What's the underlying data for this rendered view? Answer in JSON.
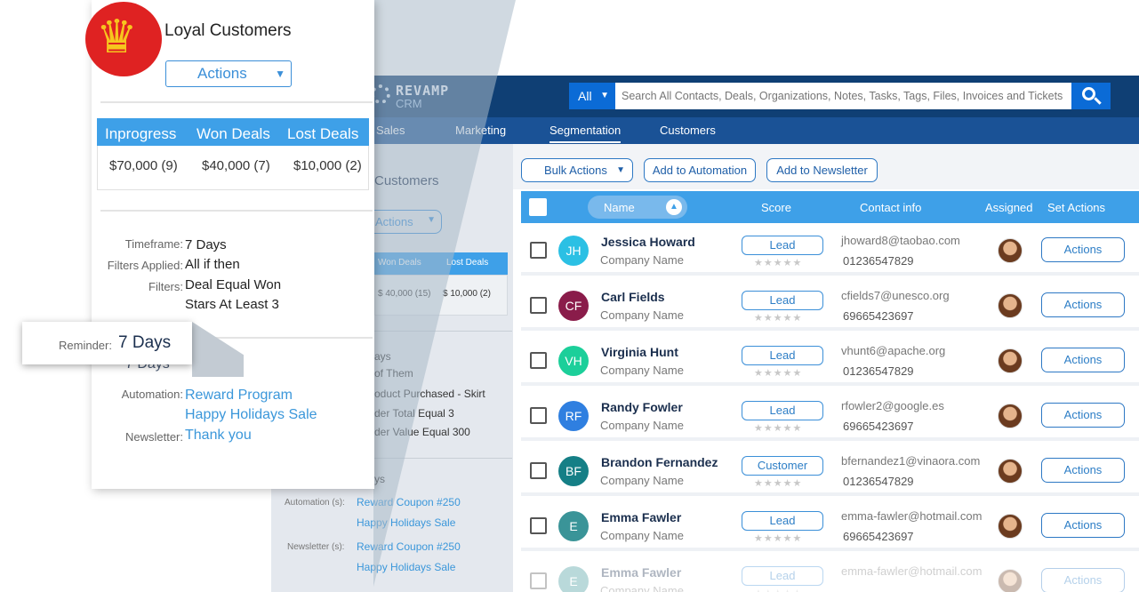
{
  "app": {
    "brand": "REVAMP",
    "brand_sub": "CRM",
    "search": {
      "scope": "All",
      "placeholder": "Search All Contacts, Deals, Organizations, Notes, Tasks, Tags, Files, Invoices and Tickets"
    },
    "nav": [
      "Sales",
      "Marketing",
      "Segmentation",
      "Customers"
    ],
    "left_panel": {
      "title": "Customers",
      "actions": "Actions",
      "won": "Won Deals",
      "lost": "Lost Deals",
      "won_val": "$ 40,000 (15)",
      "lost_val": "$ 10,000 (2)",
      "lines": [
        "ays",
        "of Them",
        "oduct Purchased - Skirt",
        "der Total Equal 3",
        "der Value Equal 300",
        "ys"
      ],
      "automation_label": "Automation (s):",
      "automation": [
        "Reward Coupon #250",
        "Happy Holidays Sale"
      ],
      "newsletter_label": "Newsletter (s):",
      "newsletter": [
        "Reward Coupon #250",
        "Happy Holidays Sale"
      ]
    },
    "toolbar": {
      "bulk": "Bulk Actions",
      "add_automation": "Add to Automation",
      "add_newsletter": "Add to Newsletter"
    },
    "table": {
      "headers": {
        "name": "Name",
        "score": "Score",
        "contact": "Contact info",
        "assigned": "Assigned",
        "set_actions": "Set Actions"
      },
      "rows": [
        {
          "initials": "JH",
          "color": "#2bc0e4",
          "name": "Jessica Howard",
          "company": "Company Name",
          "tag": "Lead",
          "email": "jhoward8@taobao.com",
          "phone": "01236547829",
          "action": "Actions"
        },
        {
          "initials": "CF",
          "color": "#8a1c4a",
          "name": "Carl Fields",
          "company": "Company Name",
          "tag": "Lead",
          "email": "cfields7@unesco.org",
          "phone": "69665423697",
          "action": "Actions"
        },
        {
          "initials": "VH",
          "color": "#1ccf9a",
          "name": "Virginia Hunt",
          "company": "Company Name",
          "tag": "Lead",
          "email": "vhunt6@apache.org",
          "phone": "01236547829",
          "action": "Actions"
        },
        {
          "initials": "RF",
          "color": "#2f7fe0",
          "name": "Randy Fowler",
          "company": "Company Name",
          "tag": "Lead",
          "email": "rfowler2@google.es",
          "phone": "69665423697",
          "action": "Actions"
        },
        {
          "initials": "BF",
          "color": "#157f86",
          "name": "Brandon Fernandez",
          "company": "Company Name",
          "tag": "Customer",
          "email": "bfernandez1@vinaora.com",
          "phone": "01236547829",
          "action": "Actions"
        },
        {
          "initials": "E",
          "color": "#3a9498",
          "name": "Emma Fawler",
          "company": "Company Name",
          "tag": "Lead",
          "email": "emma-fawler@hotmail.com",
          "phone": "69665423697",
          "action": "Actions"
        },
        {
          "initials": "E",
          "color": "#3a9498",
          "name": "Emma Fawler",
          "company": "Company Name",
          "tag": "Lead",
          "email": "emma-fawler@hotmail.com",
          "phone": "",
          "action": "Actions"
        }
      ]
    }
  },
  "card": {
    "title": "Loyal Customers",
    "actions": "Actions",
    "stats": {
      "headers": [
        "Inprogress",
        "Won Deals",
        "Lost Deals"
      ],
      "values": [
        "$70,000 (9)",
        "$40,000 (7)",
        "$10,000 (2)"
      ]
    },
    "timeframe_label": "Timeframe:",
    "timeframe": "7 Days",
    "filters_applied_label": "Filters Applied:",
    "filters_applied": "All if then",
    "filters_label": "Filters:",
    "filters": [
      "Deal Equal Won",
      "Stars At Least 3"
    ],
    "reminder_label": "Reminder:",
    "reminder": "7 Days",
    "reminder_ghost": "7 Days",
    "automation_label": "Automation:",
    "automation": [
      "Reward Program",
      "Happy Holidays Sale"
    ],
    "newsletter_label": "Newsletter:",
    "newsletter": [
      "Thank you"
    ]
  }
}
